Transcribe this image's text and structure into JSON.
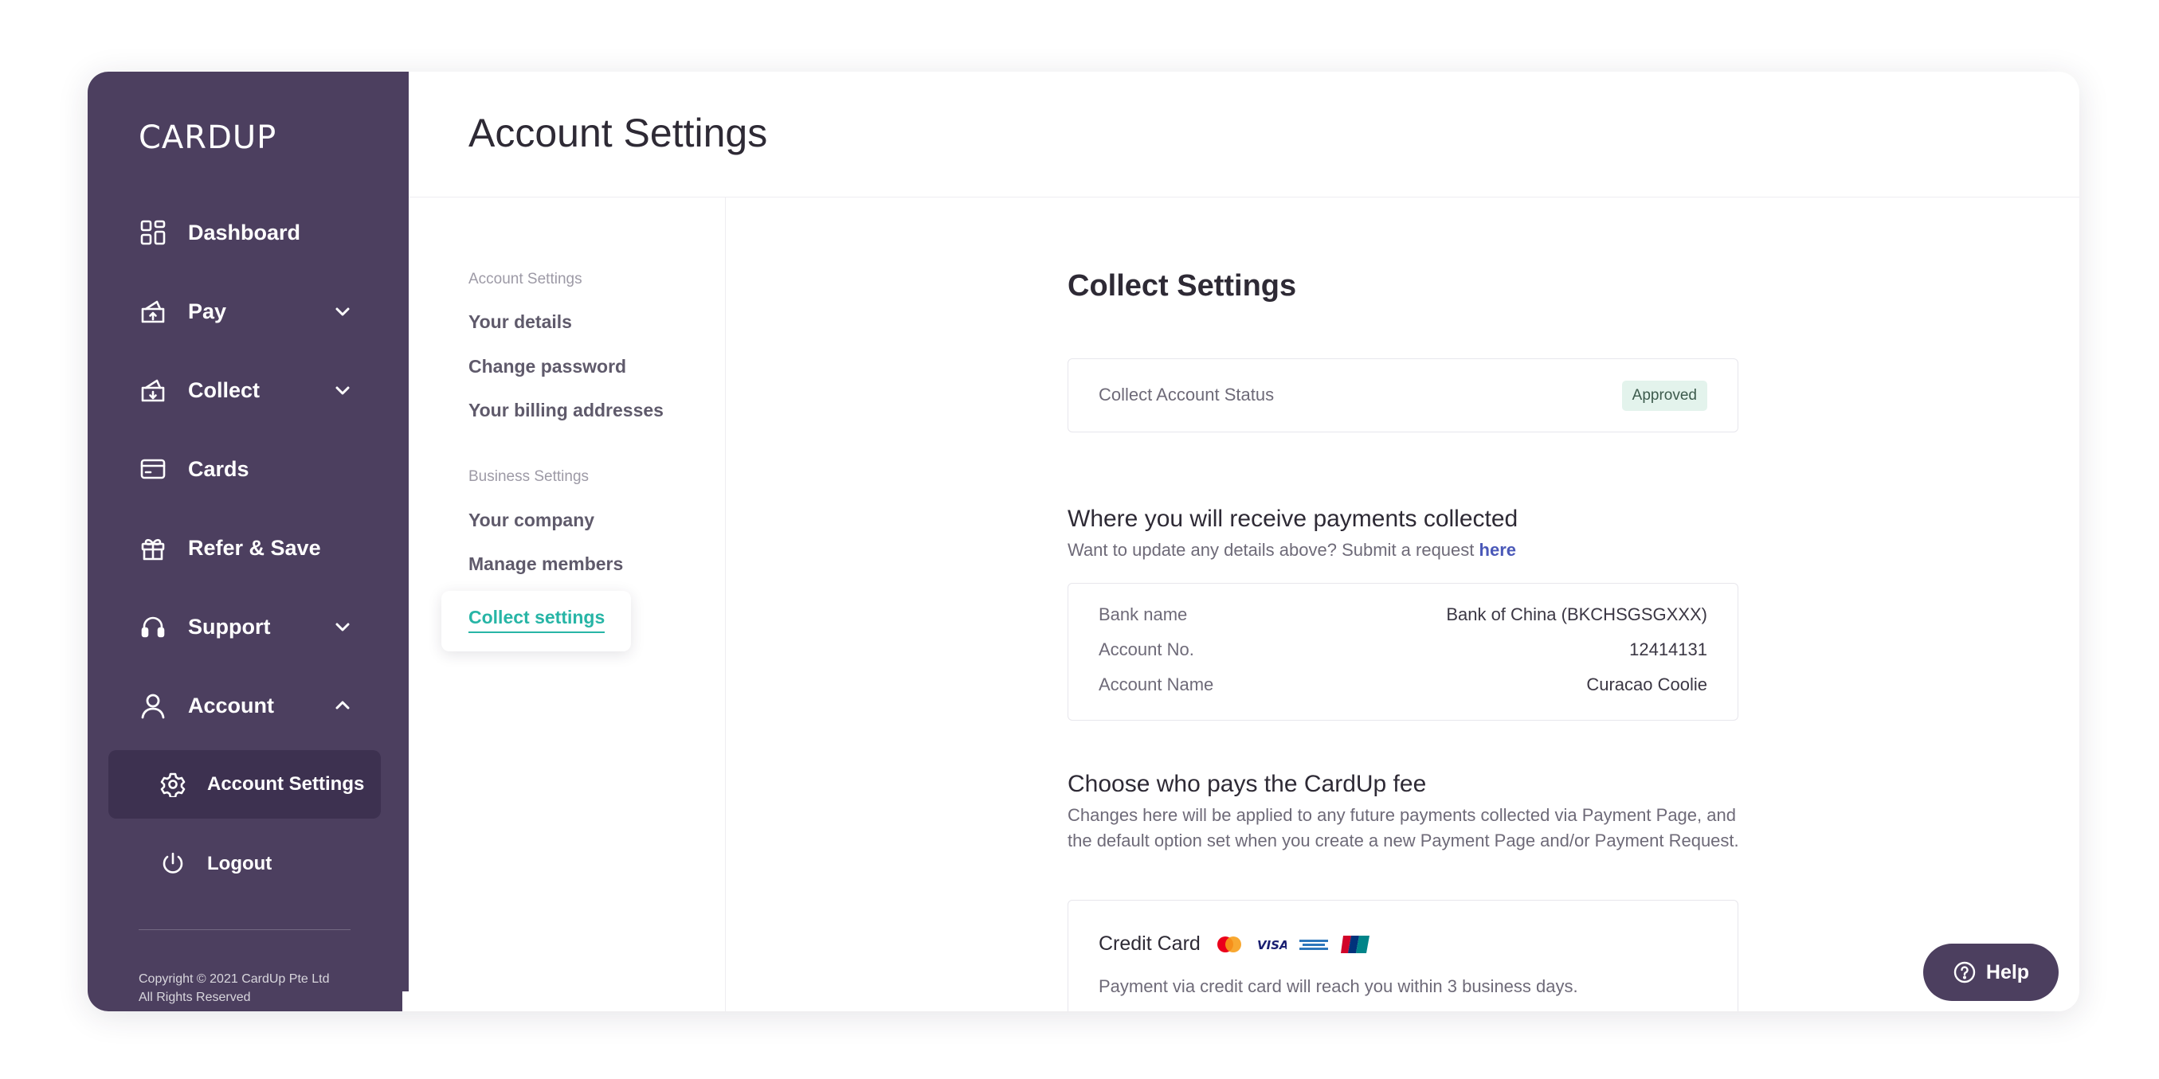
{
  "brand": {
    "logo_text": "CARDUP"
  },
  "sidebar": {
    "items": [
      {
        "label": "Dashboard",
        "icon": "dashboard-icon"
      },
      {
        "label": "Pay",
        "icon": "pay-icon",
        "expandable": true
      },
      {
        "label": "Collect",
        "icon": "collect-icon",
        "expandable": true
      },
      {
        "label": "Cards",
        "icon": "card-icon"
      },
      {
        "label": "Refer & Save",
        "icon": "gift-icon"
      },
      {
        "label": "Support",
        "icon": "headset-icon",
        "expandable": true
      },
      {
        "label": "Account",
        "icon": "user-icon",
        "expanded": true
      }
    ],
    "sub_items": [
      {
        "label": "Account Settings",
        "icon": "gear-icon",
        "active": true
      },
      {
        "label": "Logout",
        "icon": "power-icon"
      }
    ],
    "copyright": "Copyright © 2021 CardUp Pte Ltd All Rights Reserved"
  },
  "header": {
    "title": "Account Settings"
  },
  "settings_menu": {
    "account_group": "Account Settings",
    "account_links": [
      "Your details",
      "Change password",
      "Your billing addresses"
    ],
    "business_group": "Business Settings",
    "business_links": [
      "Your company",
      "Manage members",
      "Collect settings"
    ]
  },
  "content": {
    "title": "Collect Settings",
    "status": {
      "label": "Collect Account Status",
      "badge": "Approved"
    },
    "receive": {
      "title": "Where you will receive payments collected",
      "subtitle": "Want to update any details above? Submit a request ",
      "link": "here",
      "rows": [
        {
          "key": "Bank name",
          "value": "Bank of China (BKCHSGSGXXX)"
        },
        {
          "key": "Account No.",
          "value": "12414131"
        },
        {
          "key": "Account Name",
          "value": "Curacao Coolie"
        }
      ]
    },
    "fee": {
      "title": "Choose who pays the CardUp fee",
      "description": "Changes here will be applied to any future payments collected via Payment Page, and the default option set when you create a new Payment Page and/or Payment Request.",
      "credit_card": {
        "title": "Credit Card",
        "logos": [
          "mastercard-icon",
          "visa-icon",
          "amex-icon",
          "unionpay-icon"
        ],
        "visa_text": "VISA",
        "description": "Payment via credit card will reach you within 3 business days."
      }
    }
  },
  "help": {
    "label": "Help"
  }
}
